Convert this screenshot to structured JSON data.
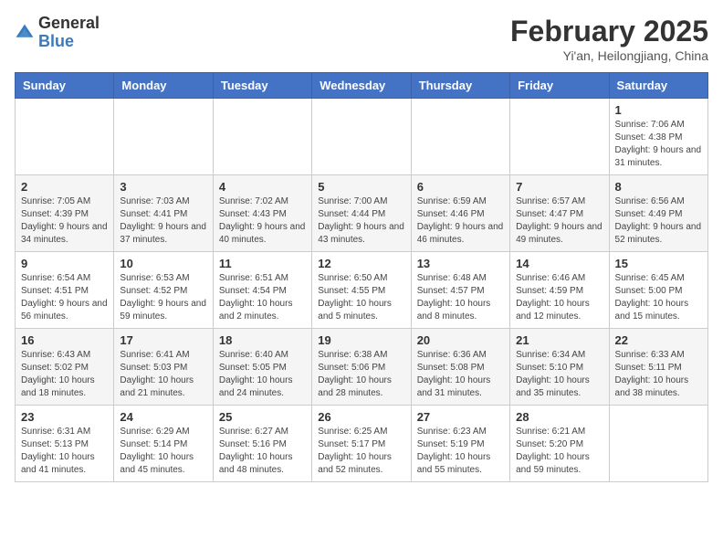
{
  "header": {
    "logo_general": "General",
    "logo_blue": "Blue",
    "month_title": "February 2025",
    "location": "Yi'an, Heilongjiang, China"
  },
  "weekdays": [
    "Sunday",
    "Monday",
    "Tuesday",
    "Wednesday",
    "Thursday",
    "Friday",
    "Saturday"
  ],
  "weeks": [
    [
      {
        "day": "",
        "info": ""
      },
      {
        "day": "",
        "info": ""
      },
      {
        "day": "",
        "info": ""
      },
      {
        "day": "",
        "info": ""
      },
      {
        "day": "",
        "info": ""
      },
      {
        "day": "",
        "info": ""
      },
      {
        "day": "1",
        "info": "Sunrise: 7:06 AM\nSunset: 4:38 PM\nDaylight: 9 hours and 31 minutes."
      }
    ],
    [
      {
        "day": "2",
        "info": "Sunrise: 7:05 AM\nSunset: 4:39 PM\nDaylight: 9 hours and 34 minutes."
      },
      {
        "day": "3",
        "info": "Sunrise: 7:03 AM\nSunset: 4:41 PM\nDaylight: 9 hours and 37 minutes."
      },
      {
        "day": "4",
        "info": "Sunrise: 7:02 AM\nSunset: 4:43 PM\nDaylight: 9 hours and 40 minutes."
      },
      {
        "day": "5",
        "info": "Sunrise: 7:00 AM\nSunset: 4:44 PM\nDaylight: 9 hours and 43 minutes."
      },
      {
        "day": "6",
        "info": "Sunrise: 6:59 AM\nSunset: 4:46 PM\nDaylight: 9 hours and 46 minutes."
      },
      {
        "day": "7",
        "info": "Sunrise: 6:57 AM\nSunset: 4:47 PM\nDaylight: 9 hours and 49 minutes."
      },
      {
        "day": "8",
        "info": "Sunrise: 6:56 AM\nSunset: 4:49 PM\nDaylight: 9 hours and 52 minutes."
      }
    ],
    [
      {
        "day": "9",
        "info": "Sunrise: 6:54 AM\nSunset: 4:51 PM\nDaylight: 9 hours and 56 minutes."
      },
      {
        "day": "10",
        "info": "Sunrise: 6:53 AM\nSunset: 4:52 PM\nDaylight: 9 hours and 59 minutes."
      },
      {
        "day": "11",
        "info": "Sunrise: 6:51 AM\nSunset: 4:54 PM\nDaylight: 10 hours and 2 minutes."
      },
      {
        "day": "12",
        "info": "Sunrise: 6:50 AM\nSunset: 4:55 PM\nDaylight: 10 hours and 5 minutes."
      },
      {
        "day": "13",
        "info": "Sunrise: 6:48 AM\nSunset: 4:57 PM\nDaylight: 10 hours and 8 minutes."
      },
      {
        "day": "14",
        "info": "Sunrise: 6:46 AM\nSunset: 4:59 PM\nDaylight: 10 hours and 12 minutes."
      },
      {
        "day": "15",
        "info": "Sunrise: 6:45 AM\nSunset: 5:00 PM\nDaylight: 10 hours and 15 minutes."
      }
    ],
    [
      {
        "day": "16",
        "info": "Sunrise: 6:43 AM\nSunset: 5:02 PM\nDaylight: 10 hours and 18 minutes."
      },
      {
        "day": "17",
        "info": "Sunrise: 6:41 AM\nSunset: 5:03 PM\nDaylight: 10 hours and 21 minutes."
      },
      {
        "day": "18",
        "info": "Sunrise: 6:40 AM\nSunset: 5:05 PM\nDaylight: 10 hours and 24 minutes."
      },
      {
        "day": "19",
        "info": "Sunrise: 6:38 AM\nSunset: 5:06 PM\nDaylight: 10 hours and 28 minutes."
      },
      {
        "day": "20",
        "info": "Sunrise: 6:36 AM\nSunset: 5:08 PM\nDaylight: 10 hours and 31 minutes."
      },
      {
        "day": "21",
        "info": "Sunrise: 6:34 AM\nSunset: 5:10 PM\nDaylight: 10 hours and 35 minutes."
      },
      {
        "day": "22",
        "info": "Sunrise: 6:33 AM\nSunset: 5:11 PM\nDaylight: 10 hours and 38 minutes."
      }
    ],
    [
      {
        "day": "23",
        "info": "Sunrise: 6:31 AM\nSunset: 5:13 PM\nDaylight: 10 hours and 41 minutes."
      },
      {
        "day": "24",
        "info": "Sunrise: 6:29 AM\nSunset: 5:14 PM\nDaylight: 10 hours and 45 minutes."
      },
      {
        "day": "25",
        "info": "Sunrise: 6:27 AM\nSunset: 5:16 PM\nDaylight: 10 hours and 48 minutes."
      },
      {
        "day": "26",
        "info": "Sunrise: 6:25 AM\nSunset: 5:17 PM\nDaylight: 10 hours and 52 minutes."
      },
      {
        "day": "27",
        "info": "Sunrise: 6:23 AM\nSunset: 5:19 PM\nDaylight: 10 hours and 55 minutes."
      },
      {
        "day": "28",
        "info": "Sunrise: 6:21 AM\nSunset: 5:20 PM\nDaylight: 10 hours and 59 minutes."
      },
      {
        "day": "",
        "info": ""
      }
    ]
  ]
}
